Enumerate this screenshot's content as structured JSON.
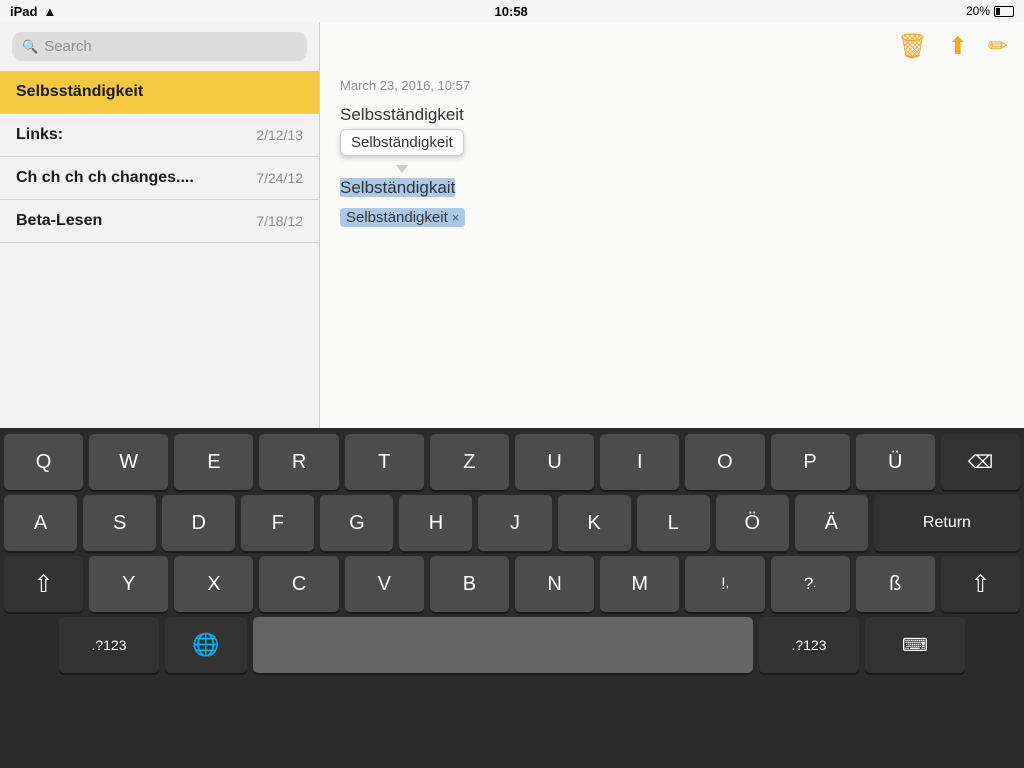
{
  "statusBar": {
    "device": "iPad",
    "wifi": "wifi-icon",
    "time": "10:58",
    "battery": "20%"
  },
  "sidebar": {
    "searchPlaceholder": "Search",
    "notes": [
      {
        "title": "Selbsständigkeit",
        "date": "",
        "active": true
      },
      {
        "title": "Links:",
        "date": "2/12/13",
        "active": false
      },
      {
        "title": "Ch ch ch ch changes....",
        "date": "7/24/12",
        "active": false
      },
      {
        "title": "Beta-Lesen",
        "date": "7/18/12",
        "active": false
      }
    ]
  },
  "content": {
    "timestamp": "March 23, 2016, 10:57",
    "line1": "Selbsständigkeit",
    "line2Selected": "Selbständigkait",
    "autocorrectSuggestion": "Selbständigkeit",
    "line3Tag": "Selbständigkeit",
    "closeSymbol": "×"
  },
  "toolbar": {
    "deleteLabel": "🗑",
    "shareLabel": "⬆",
    "editLabel": "✎"
  },
  "keyboard": {
    "rows": [
      [
        "Q",
        "W",
        "E",
        "R",
        "T",
        "Z",
        "U",
        "I",
        "O",
        "P",
        "Ü",
        "⌫"
      ],
      [
        "A",
        "S",
        "D",
        "F",
        "G",
        "H",
        "J",
        "K",
        "L",
        "Ö",
        "Ä",
        "Return"
      ],
      [
        "⇧",
        "Y",
        "X",
        "C",
        "V",
        "B",
        "N",
        "M",
        "!,",
        "?.",
        "ß",
        "⇧"
      ],
      [
        ".?123",
        "🌐",
        " ",
        ".?123",
        "⌨"
      ]
    ]
  }
}
